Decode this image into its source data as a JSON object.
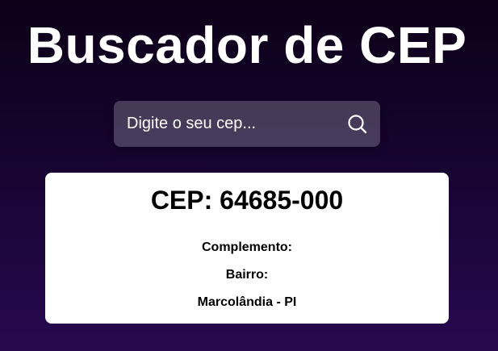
{
  "header": {
    "title": "Buscador de CEP"
  },
  "search": {
    "placeholder": "Digite o seu cep...",
    "value": "",
    "icon": "search-icon"
  },
  "result": {
    "cep_label": "CEP: 64685-000",
    "complemento_label": "Complemento:",
    "bairro_label": "Bairro:",
    "cidade_uf": "Marcolândia - PI"
  },
  "colors": {
    "background_top": "#0d0018",
    "background_bottom": "#27094f",
    "card_background": "#ffffff",
    "text_light": "#ffffff",
    "text_dark": "#000000"
  }
}
